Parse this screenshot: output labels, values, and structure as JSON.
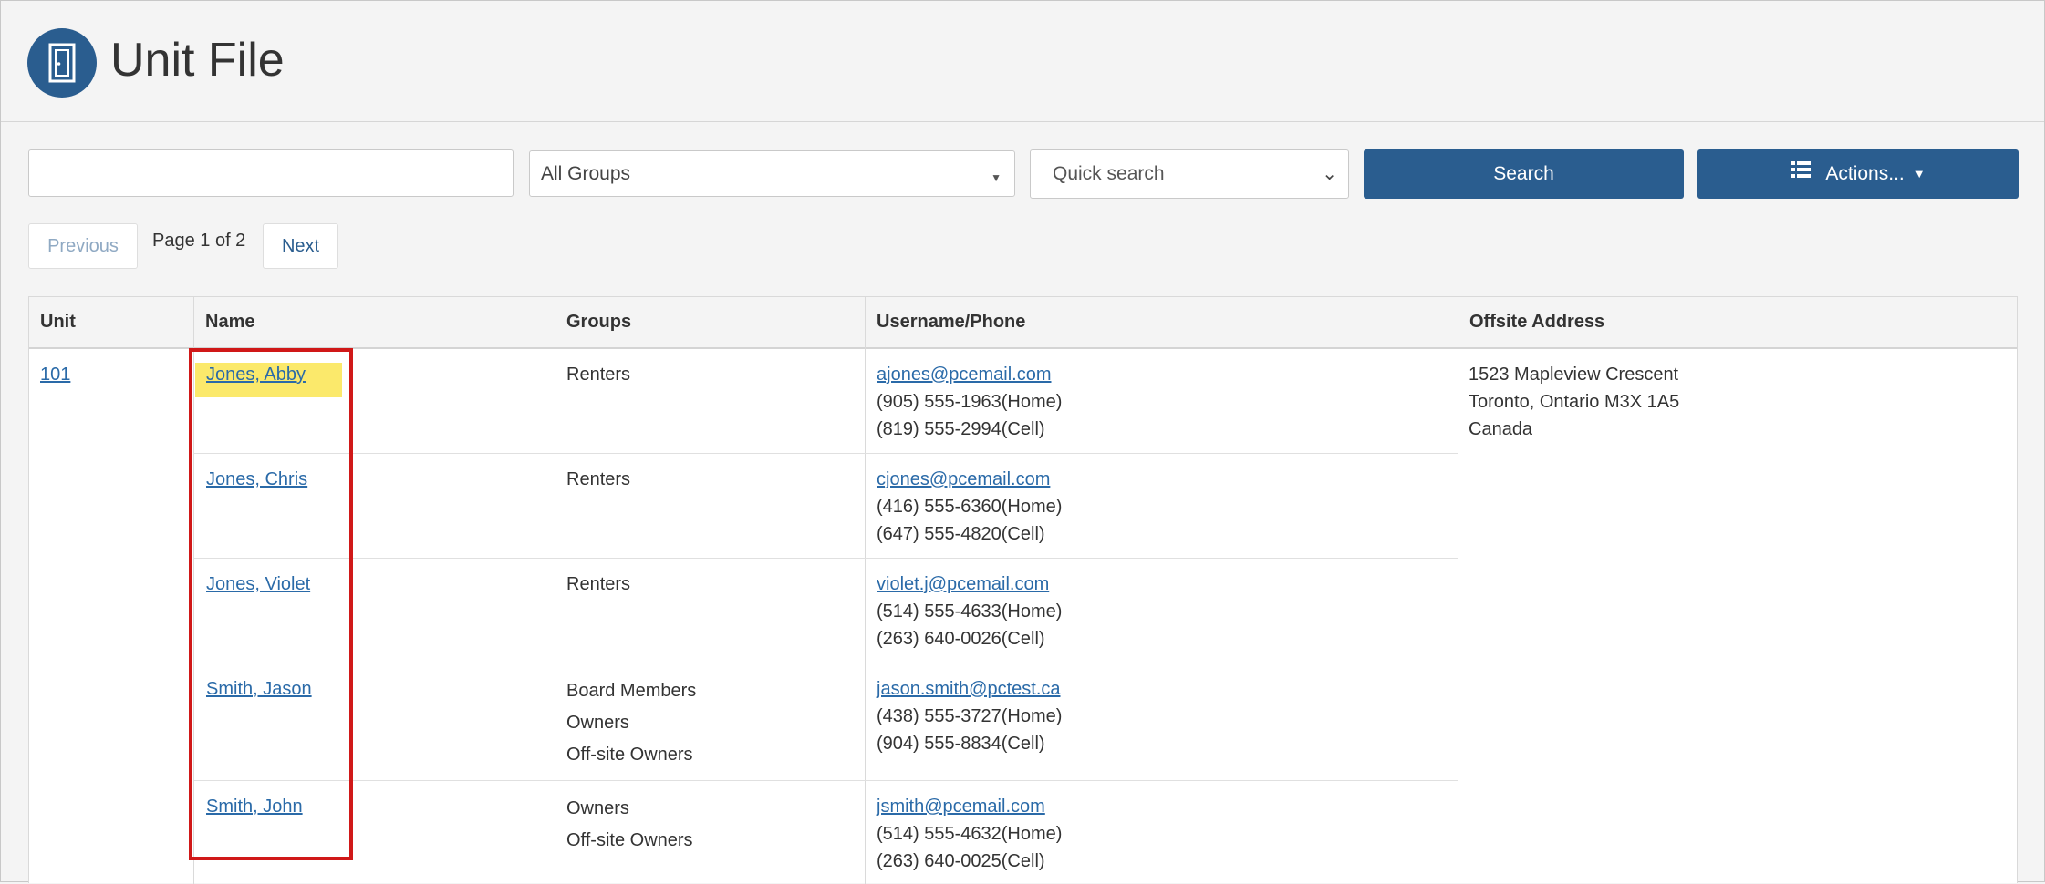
{
  "header": {
    "title": "Unit File",
    "icon": "door-icon"
  },
  "toolbar": {
    "search_value": "",
    "group_select": "All Groups",
    "quick_search": "Quick search",
    "search_button": "Search",
    "actions_button": "Actions...",
    "actions_icon": "list-icon"
  },
  "pager": {
    "previous": "Previous",
    "label": "Page 1 of 2",
    "next": "Next"
  },
  "table": {
    "headers": [
      "Unit",
      "Name",
      "Groups",
      "Username/Phone",
      "Offsite Address"
    ],
    "unit": "101",
    "offsite_address": [
      "1523 Mapleview Crescent",
      "Toronto, Ontario M3X 1A5",
      "Canada"
    ],
    "rows": [
      {
        "name": "Jones, Abby",
        "groups": [
          "Renters"
        ],
        "email": "ajones@pcemail.com",
        "phones": [
          "(905) 555-1963(Home)",
          "(819) 555-2994(Cell)"
        ]
      },
      {
        "name": "Jones, Chris",
        "groups": [
          "Renters"
        ],
        "email": "cjones@pcemail.com",
        "phones": [
          "(416) 555-6360(Home)",
          "(647) 555-4820(Cell)"
        ]
      },
      {
        "name": "Jones, Violet",
        "groups": [
          "Renters"
        ],
        "email": "violet.j@pcemail.com",
        "phones": [
          "(514) 555-4633(Home)",
          "(263) 640-0026(Cell)"
        ]
      },
      {
        "name": "Smith, Jason",
        "groups": [
          "Board Members",
          "Owners",
          "Off-site Owners"
        ],
        "email": "jason.smith@pctest.ca",
        "phones": [
          "(438) 555-3727(Home)",
          "(904) 555-8834(Cell)"
        ]
      },
      {
        "name": "Smith, John",
        "groups": [
          "Owners",
          "Off-site Owners"
        ],
        "email": "jsmith@pcemail.com",
        "phones": [
          "(514) 555-4632(Home)",
          "(263) 640-0025(Cell)"
        ]
      }
    ]
  },
  "colors": {
    "primary": "#2a5d8f",
    "link": "#2a6aa8",
    "highlight": "#fbe96b",
    "annotation": "#d01818"
  }
}
